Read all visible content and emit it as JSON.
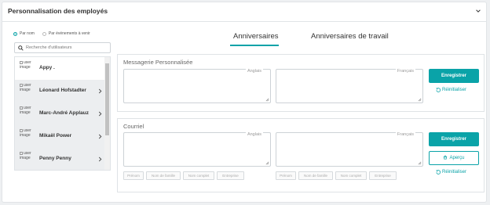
{
  "header": {
    "title": "Personnalisation des employés"
  },
  "filter": {
    "option1": "Par nom",
    "option2": "Par événements à venir"
  },
  "search": {
    "placeholder": "Recherche d'utilisateurs"
  },
  "users": [
    {
      "name": "Appy .",
      "img_alt": "user image"
    },
    {
      "name": "Léonard Hofstadter",
      "img_alt": "user image"
    },
    {
      "name": "Marc-André Applauz",
      "img_alt": "user image"
    },
    {
      "name": "Mikaël Power",
      "img_alt": "user image"
    },
    {
      "name": "Penny Penny",
      "img_alt": "user image"
    }
  ],
  "tabs": {
    "active": "Anniversaires",
    "other": "Anniversaires de travail"
  },
  "message_section": {
    "title": "Messagerie Personnalisée",
    "lang_en": "Anglais",
    "lang_fr": "Français",
    "save": "Enregistrer",
    "reset": "Réinitialiser"
  },
  "email_section": {
    "title": "Courriel",
    "lang_en": "Anglais",
    "lang_fr": "Français",
    "save": "Enregistrer",
    "preview": "Aperçu",
    "reset": "Réinitialiser",
    "chips": [
      "Prénom",
      "Nom de famille",
      "Nom complet",
      "Entreprise"
    ]
  },
  "colors": {
    "accent": "#0aa3a8"
  }
}
